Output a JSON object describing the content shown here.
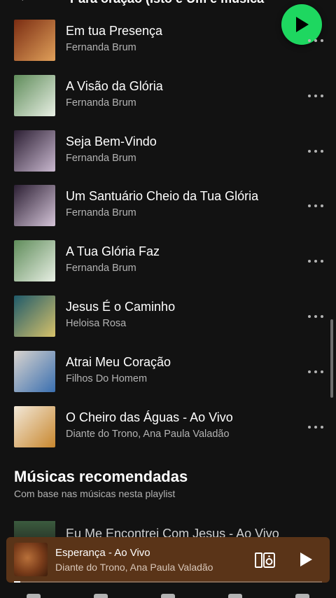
{
  "header": {
    "title": "Para oração (Isto é Um e música p..."
  },
  "tracks": [
    {
      "title": "Em tua Presença",
      "artist": "Fernanda Brum",
      "cover": [
        "#7a2c12",
        "#e0a05a"
      ]
    },
    {
      "title": "A Visão da Glória",
      "artist": "Fernanda Brum",
      "cover": [
        "#5f8c5a",
        "#e8efe4"
      ]
    },
    {
      "title": "Seja Bem-Vindo",
      "artist": "Fernanda Brum",
      "cover": [
        "#2c1f33",
        "#c9b8cf"
      ]
    },
    {
      "title": "Um Santuário Cheio da Tua Glória",
      "artist": "Fernanda Brum",
      "cover": [
        "#2c1f33",
        "#d4c4d8"
      ]
    },
    {
      "title": "A Tua Glória Faz",
      "artist": "Fernanda Brum",
      "cover": [
        "#5f8c5a",
        "#e8efe4"
      ]
    },
    {
      "title": "Jesus É o Caminho",
      "artist": "Heloisa Rosa",
      "cover": [
        "#1f5a6a",
        "#d7c26a"
      ]
    },
    {
      "title": "Atrai Meu Coração",
      "artist": "Filhos Do Homem",
      "cover": [
        "#d9d4cf",
        "#3a6fb0"
      ]
    },
    {
      "title": "O Cheiro das Águas - Ao Vivo",
      "artist": "Diante do Trono, Ana Paula Valadão",
      "cover": [
        "#f2e8d8",
        "#c8872e"
      ]
    }
  ],
  "recommended": {
    "title": "Músicas recomendadas",
    "subtitle": "Com base nas músicas nesta playlist",
    "peek_title": "Eu Me Encontrei Com Jesus - Ao Vivo"
  },
  "player": {
    "title": "Esperança - Ao Vivo",
    "artist": "Diante do Trono, Ana Paula Valadão",
    "progress": 0.02
  },
  "colors": {
    "accent": "#1ed760",
    "background": "#121212",
    "player_bg": "#5a3418"
  }
}
